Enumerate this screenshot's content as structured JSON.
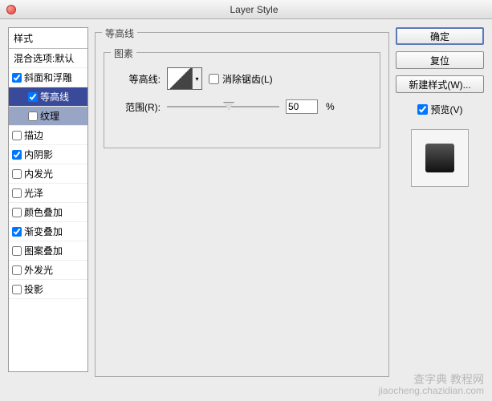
{
  "window": {
    "title": "Layer Style"
  },
  "styles": {
    "header": "样式",
    "blend": "混合选项:默认",
    "items": [
      {
        "label": "斜面和浮雕",
        "checked": true
      },
      {
        "label": "等高线",
        "checked": true
      },
      {
        "label": "纹理",
        "checked": false
      },
      {
        "label": "描边",
        "checked": false
      },
      {
        "label": "内阴影",
        "checked": true
      },
      {
        "label": "内发光",
        "checked": false
      },
      {
        "label": "光泽",
        "checked": false
      },
      {
        "label": "颜色叠加",
        "checked": false
      },
      {
        "label": "渐变叠加",
        "checked": true
      },
      {
        "label": "图案叠加",
        "checked": false
      },
      {
        "label": "外发光",
        "checked": false
      },
      {
        "label": "投影",
        "checked": false
      }
    ]
  },
  "contour": {
    "group_title": "等高线",
    "inner_title": "图素",
    "contour_label": "等高线:",
    "antialias": "消除锯齿(L)",
    "range_label": "范围(R):",
    "range_value": "50",
    "range_unit": "%"
  },
  "buttons": {
    "ok": "确定",
    "cancel": "复位",
    "new_style": "新建样式(W)...",
    "preview": "预览(V)"
  },
  "watermark": {
    "line1": "查字典 教程网",
    "line2": "jiaocheng.chazidian.com"
  }
}
